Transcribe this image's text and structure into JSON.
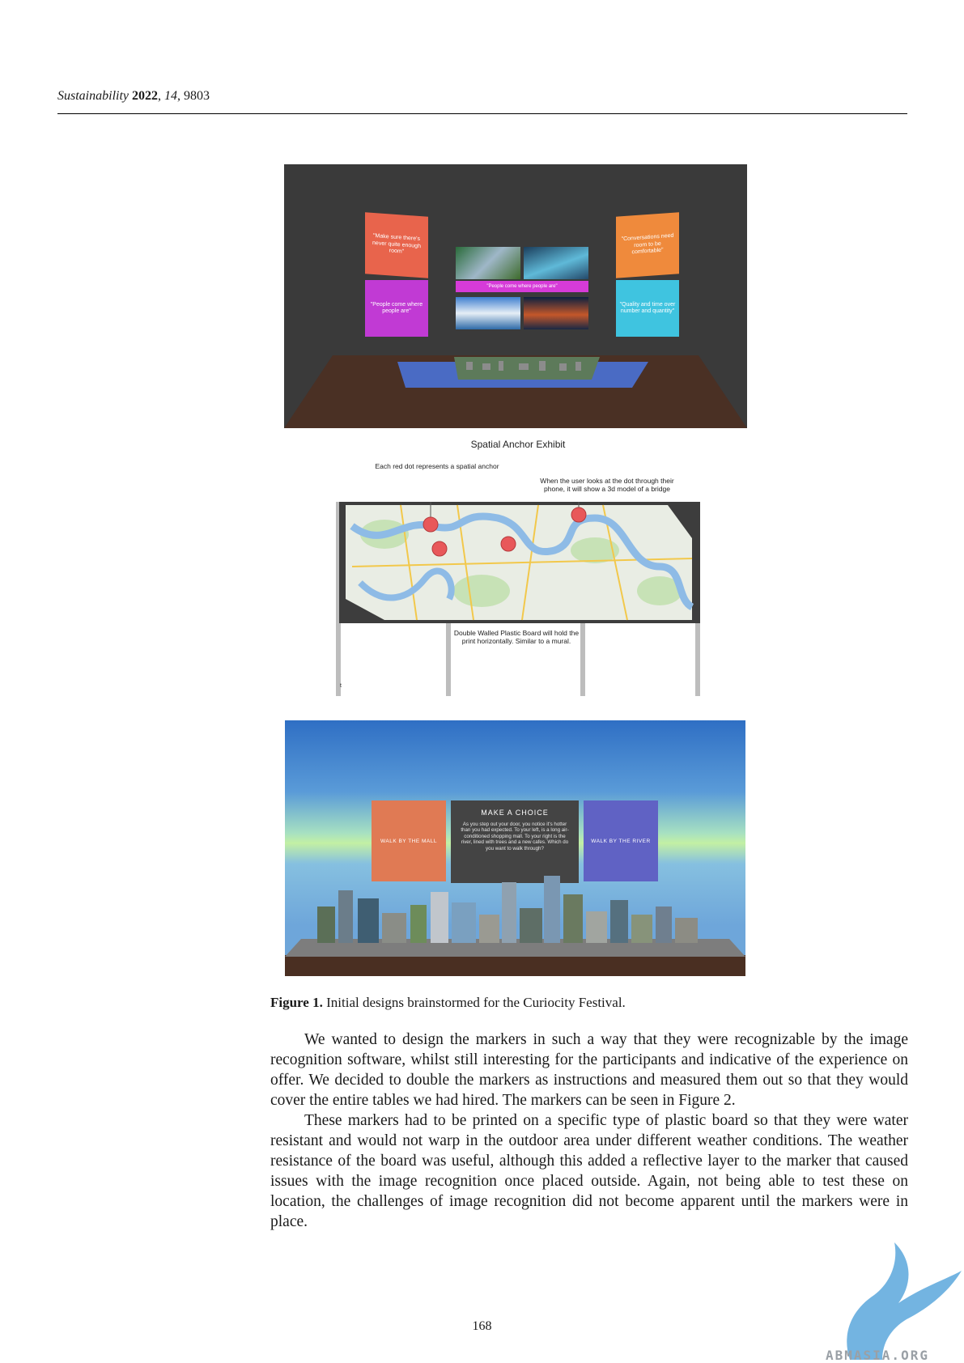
{
  "header": {
    "journal": "Sustainability",
    "year": "2022",
    "volume": "14",
    "article": "9803"
  },
  "figure1": {
    "panel1": {
      "cards": [
        {
          "text": "\"Make sure there's never quite enough room\"",
          "color": "#e8644c"
        },
        {
          "text": "\"People come where people are\"",
          "color": "#c13ad4"
        },
        {
          "text": "\"Conversations need room to be comfortable\"",
          "color": "#ef8a3c"
        },
        {
          "text": "\"Quality and time over number and quantity\"",
          "color": "#3fc4e0"
        }
      ],
      "banner": "\"People come where people are\""
    },
    "panel2": {
      "title": "Spatial Anchor Exhibit",
      "note_red_dot": "Each red dot represents a spatial anchor",
      "note_user_looks": "When the user looks at the dot through their phone, it will show a 3d model of a bridge",
      "note_board": "Double Walled Plastic Board will hold the print horizontally. Similar to a mural.",
      "post_marker": "t"
    },
    "panel3": {
      "left_choice": "WALK BY THE MALL",
      "center_title": "MAKE A CHOICE",
      "center_text": "As you step out your door, you notice it's hotter than you had expected. To your left, is a long air-conditioned shopping mall. To your right is the river, lined with trees and a new cafes. Which do you want to walk through?",
      "right_choice": "WALK BY THE RIVER",
      "colors": {
        "left": "#e07a54",
        "center": "#444444",
        "right": "#6062c4"
      }
    },
    "caption_label": "Figure 1.",
    "caption_text": "Initial designs brainstormed for the Curiocity Festival."
  },
  "body": {
    "paragraph1": "We wanted to design the markers in such a way that they were recognizable by the image recognition software, whilst still interesting for the participants and indicative of the experience on offer. We decided to double the markers as instructions and measured them out so that they would cover the entire tables we had hired. The markers can be seen in Figure 2.",
    "paragraph2": "These markers had to be printed on a specific type of plastic board so that they were water resistant and would not warp in the outdoor area under different weather conditions. The weather resistance of the board was useful, although this added a reflective layer to the marker that caused issues with the image recognition once placed outside. Again, not being able to test these on location, the challenges of image recognition did not become apparent until the markers were in place."
  },
  "page_number": "168",
  "watermark": "ABMASIA.ORG"
}
